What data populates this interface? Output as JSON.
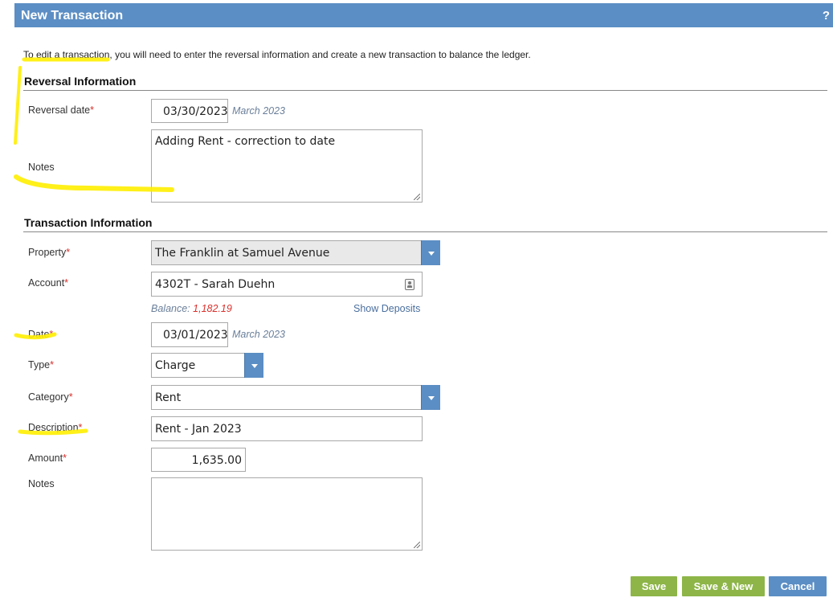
{
  "header": {
    "title": "New Transaction",
    "help": "?"
  },
  "intro": "To edit a transaction, you will need to enter the reversal information and create a new transaction to balance the ledger.",
  "reversal": {
    "section_title": "Reversal Information",
    "date_label": "Reversal date",
    "date_value": "03/30/2023",
    "date_hint": "March 2023",
    "notes_label": "Notes",
    "notes_value": "Adding Rent - correction to date"
  },
  "transaction": {
    "section_title": "Transaction Information",
    "property_label": "Property",
    "property_value": "The Franklin at Samuel Avenue",
    "account_label": "Account",
    "account_value": "4302T - Sarah Duehn",
    "balance_label": "Balance:",
    "balance_value": "1,182.19",
    "show_deposits": "Show Deposits",
    "date_label": "Date",
    "date_value": "03/01/2023",
    "date_hint": "March 2023",
    "type_label": "Type",
    "type_value": "Charge",
    "category_label": "Category",
    "category_value": "Rent",
    "description_label": "Description",
    "description_value": "Rent - Jan 2023",
    "amount_label": "Amount",
    "amount_value": "1,635.00",
    "notes_label": "Notes",
    "notes_value": ""
  },
  "required_marker": "*",
  "buttons": {
    "save": "Save",
    "save_new": "Save & New",
    "cancel": "Cancel"
  },
  "colors": {
    "header": "#5b8ec4",
    "green_button": "#8db548",
    "highlight": "#ffee00",
    "required": "#d9302b"
  },
  "icons": {
    "contact": "contact-card-icon",
    "dropdown": "chevron-down-icon",
    "resize": "resize-handle-icon"
  }
}
